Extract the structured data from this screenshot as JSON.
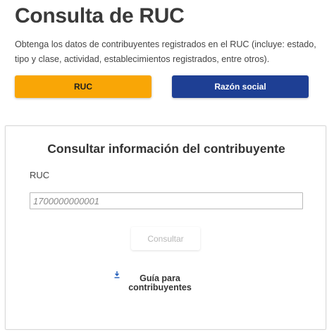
{
  "header": {
    "title": "Consulta de RUC",
    "subtitle": "Obtenga los datos de contribuyentes registrados en el RUC (incluye: estado, tipo y clase, actividad, establecimientos registrados, entre otros)."
  },
  "tabs": {
    "ruc_label": "RUC",
    "razon_label": "Razón social"
  },
  "form": {
    "title": "Consultar información del contribuyente",
    "field_label": "RUC",
    "input_value": "",
    "input_placeholder": "1700000000001",
    "submit_label": "Consultar"
  },
  "guide": {
    "label_line1": "Guía para",
    "label_line2": "contribuyentes",
    "icon": "download-icon"
  },
  "colors": {
    "ruc_tab": "#f9a606",
    "razon_tab": "#1e3f94",
    "guide_icon": "#1e5bb8"
  }
}
